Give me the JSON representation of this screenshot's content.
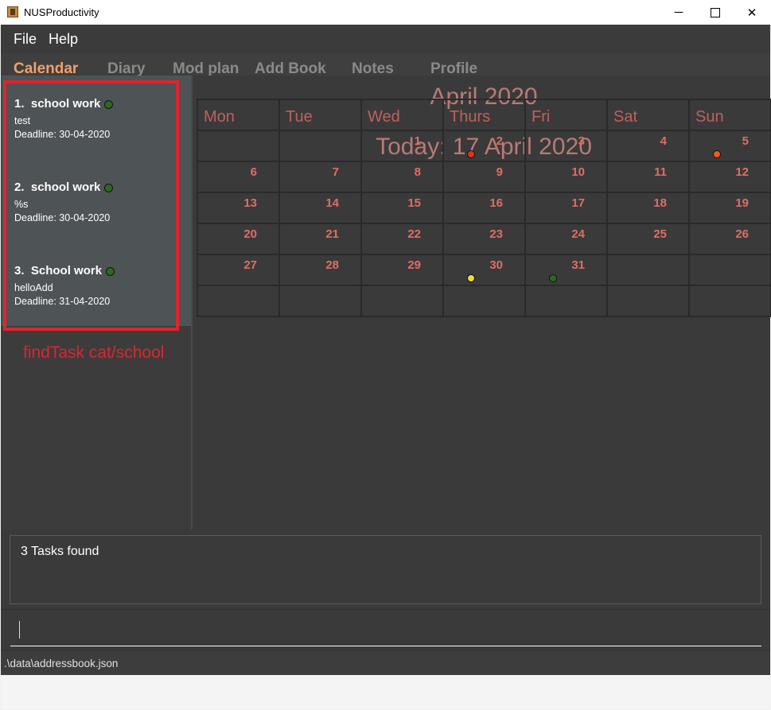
{
  "window": {
    "title": "NUSProductivity",
    "controls": {
      "minimize": "─",
      "close": "✕"
    }
  },
  "menu": [
    "File",
    "Help"
  ],
  "tabs": [
    {
      "label": "Calendar",
      "active": true
    },
    {
      "label": "Diary",
      "active": false
    },
    {
      "label": "Mod plan",
      "active": false
    },
    {
      "label": "Add Book",
      "active": false
    },
    {
      "label": "Notes",
      "active": false
    },
    {
      "label": "Profile",
      "active": false
    }
  ],
  "tasks": [
    {
      "index": "1.",
      "title": "school work",
      "description": "test",
      "deadline": "Deadline: 30-04-2020"
    },
    {
      "index": "2.",
      "title": "school work",
      "description": "%s",
      "deadline": "Deadline: 30-04-2020"
    },
    {
      "index": "3.",
      "title": "School work",
      "description": "helloAdd",
      "deadline": "Deadline: 31-04-2020"
    }
  ],
  "annotation": "findTask cat/school",
  "calendar": {
    "month_title": "April 2020",
    "today_title": "Today: 17 April 2020",
    "day_headers": [
      "Mon",
      "Tue",
      "Wed",
      "Thurs",
      "Fri",
      "Sat",
      "Sun"
    ],
    "weeks": [
      [
        "",
        "",
        "1",
        "2",
        "3",
        "4",
        "5"
      ],
      [
        "6",
        "7",
        "8",
        "9",
        "10",
        "11",
        "12"
      ],
      [
        "13",
        "14",
        "15",
        "16",
        "17",
        "18",
        "19"
      ],
      [
        "20",
        "21",
        "22",
        "23",
        "24",
        "25",
        "26"
      ],
      [
        "27",
        "28",
        "29",
        "30",
        "31",
        "",
        ""
      ],
      [
        "",
        "",
        "",
        "",
        "",
        "",
        ""
      ]
    ],
    "markers": [
      {
        "week": 0,
        "day": 3,
        "color": "#e0341a"
      },
      {
        "week": 0,
        "day": 6,
        "color": "#f05a22"
      },
      {
        "week": 4,
        "day": 3,
        "color": "#e8e03a"
      },
      {
        "week": 4,
        "day": 4,
        "color": "#2b6b1f"
      }
    ]
  },
  "result_text": "3 Tasks found",
  "status": ".\\data\\addressbook.json"
}
